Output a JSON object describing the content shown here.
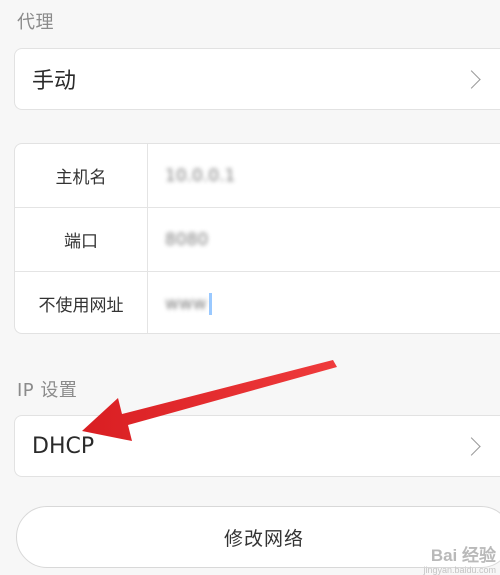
{
  "proxy": {
    "section_label": "代理",
    "mode_value": "手动"
  },
  "proxy_table": {
    "rows": [
      {
        "key": "主机名",
        "value": "10.0.0.1"
      },
      {
        "key": "端口",
        "value": "8080"
      },
      {
        "key": "不使用网址",
        "value": "www"
      }
    ]
  },
  "ip": {
    "section_label": "IP 设置",
    "mode_value": "DHCP"
  },
  "actions": {
    "modify_network_label": "修改网络"
  },
  "watermark": {
    "main": "Bai 经验",
    "sub": "jingyan.baidu.com"
  },
  "annotation": {
    "arrow_color": "#e8282b"
  },
  "icons": {
    "row_chevron": "chevron-right-icon"
  }
}
